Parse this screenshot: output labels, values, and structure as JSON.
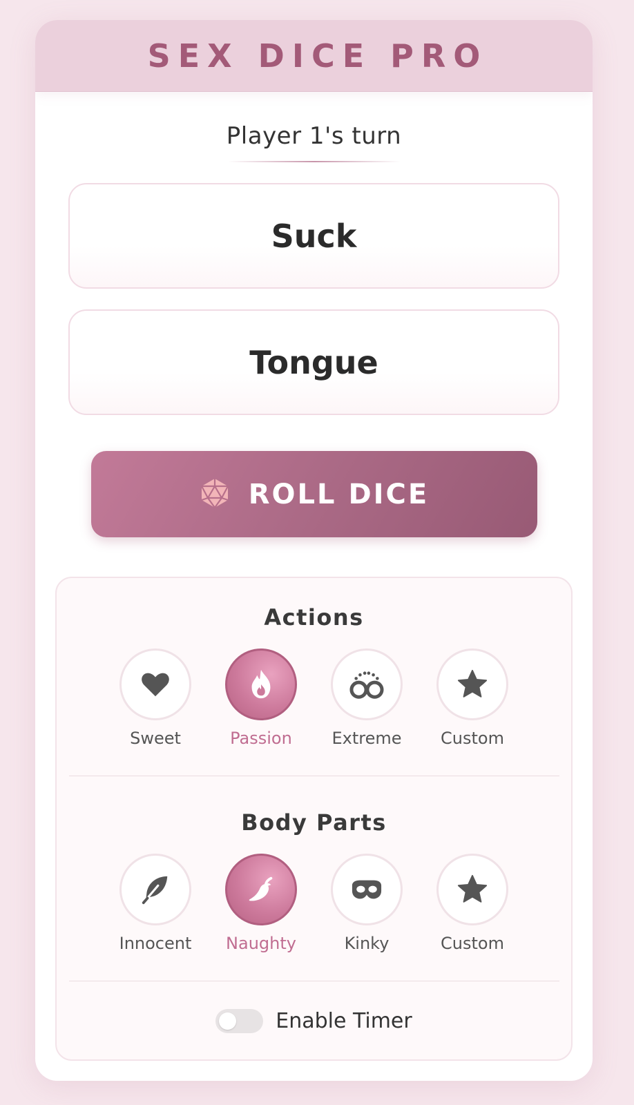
{
  "app": {
    "title": "SEX DICE PRO"
  },
  "turn": {
    "text": "Player 1's turn"
  },
  "results": {
    "action": "Suck",
    "body_part": "Tongue"
  },
  "roll_button": {
    "label": "ROLL DICE",
    "icon": "d20-dice-icon"
  },
  "actions": {
    "title": "Actions",
    "options": [
      {
        "label": "Sweet",
        "icon": "heart-icon",
        "active": false
      },
      {
        "label": "Passion",
        "icon": "flame-icon",
        "active": true
      },
      {
        "label": "Extreme",
        "icon": "handcuffs-icon",
        "active": false
      },
      {
        "label": "Custom",
        "icon": "star-icon",
        "active": false
      }
    ]
  },
  "body_parts": {
    "title": "Body Parts",
    "options": [
      {
        "label": "Innocent",
        "icon": "feather-icon",
        "active": false
      },
      {
        "label": "Naughty",
        "icon": "pepper-icon",
        "active": true
      },
      {
        "label": "Kinky",
        "icon": "mask-icon",
        "active": false
      },
      {
        "label": "Custom",
        "icon": "star-icon",
        "active": false
      }
    ]
  },
  "timer": {
    "label": "Enable Timer",
    "enabled": false
  },
  "colors": {
    "accent": "#b0688a",
    "header_bg": "#ebd0dc",
    "page_bg": "#f6e6ec"
  }
}
